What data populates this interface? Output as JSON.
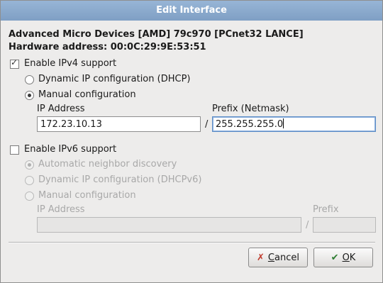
{
  "dialog": {
    "title": "Edit Interface"
  },
  "device": {
    "name": "Advanced Micro Devices [AMD] 79c970 [PCnet32 LANCE]",
    "hw_label": "Hardware address:",
    "hw_address": "00:0C:29:9E:53:51"
  },
  "ipv4": {
    "enable_label": "Enable IPv4 support",
    "enabled": true,
    "dhcp_label": "Dynamic IP configuration (DHCP)",
    "manual_label": "Manual configuration",
    "ip_label": "IP Address",
    "ip_value": "172.23.10.13",
    "slash": "/",
    "prefix_label": "Prefix (Netmask)",
    "prefix_value": "255.255.255.0"
  },
  "ipv6": {
    "enable_label": "Enable IPv6 support",
    "enabled": false,
    "auto_label": "Automatic neighbor discovery",
    "dhcp_label": "Dynamic IP configuration (DHCPv6)",
    "manual_label": "Manual configuration",
    "ip_label": "IP Address",
    "slash": "/",
    "prefix_label": "Prefix"
  },
  "buttons": {
    "cancel_mnemonic": "C",
    "cancel_rest": "ancel",
    "ok_mnemonic": "O",
    "ok_rest": "K"
  },
  "icons": {
    "check": "check-mark-icon",
    "cancel": "x-icon",
    "ok": "checkmark-hand-icon"
  },
  "colors": {
    "title_bar": "#8aa9cd",
    "focus_border": "#5f8ec6"
  }
}
